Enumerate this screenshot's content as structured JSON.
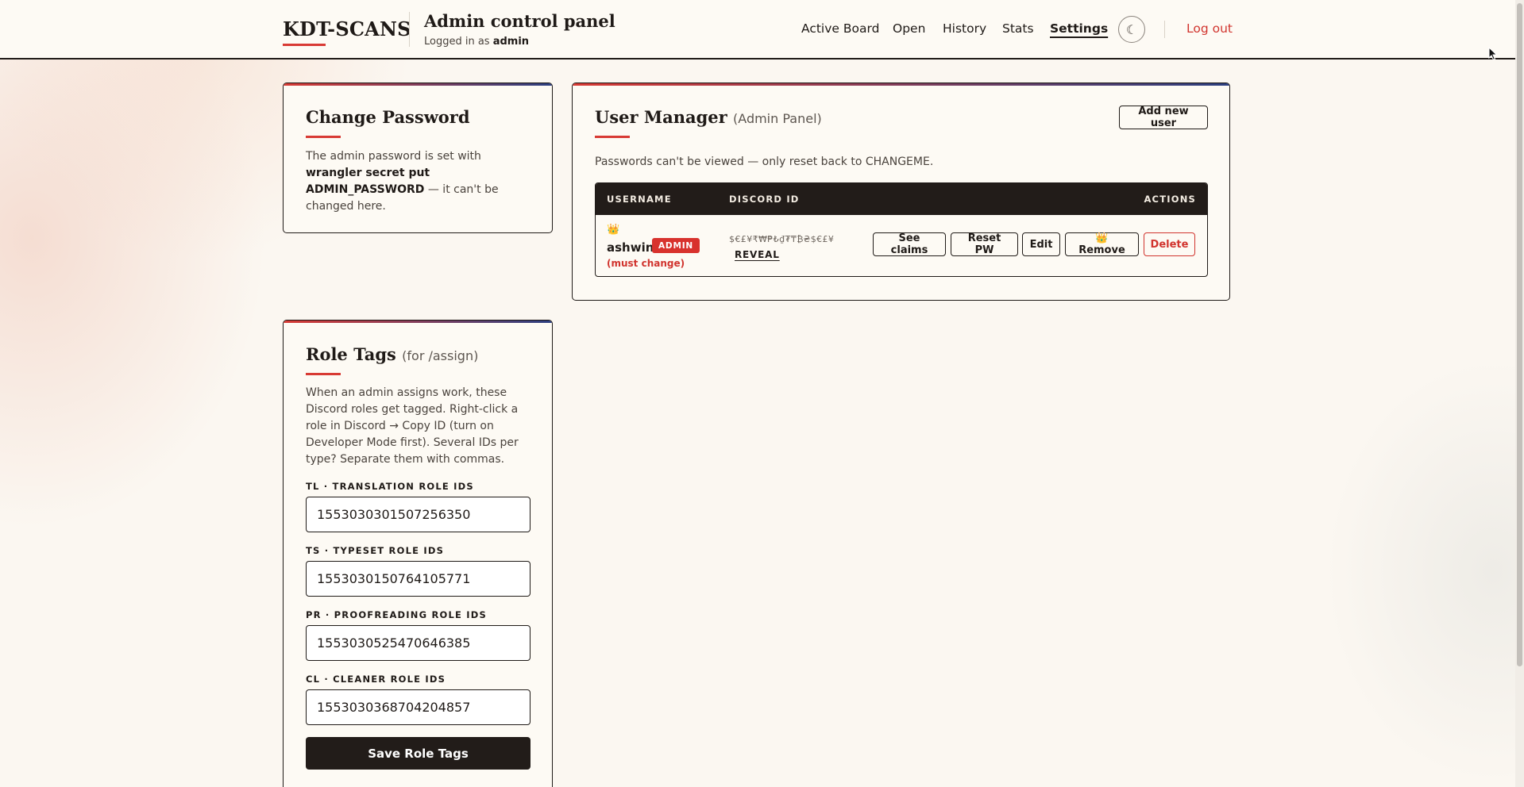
{
  "header": {
    "brand": "KDT-SCANS",
    "title": "Admin control panel",
    "logged_in_prefix": "Logged in as",
    "logged_in_user": "admin",
    "nav": [
      {
        "label": "Active Board"
      },
      {
        "label": "Open"
      },
      {
        "label": "History"
      },
      {
        "label": "Stats"
      },
      {
        "label": "Settings",
        "active": true
      }
    ],
    "theme_toggle_icon": "☾",
    "logout": "Log out"
  },
  "change_password": {
    "title": "Change Password",
    "text_1": "The admin password is set with ",
    "text_bold": "wrangler secret put ADMIN_PASSWORD",
    "text_2": " — it can't be changed here."
  },
  "user_manager": {
    "title": "User Manager",
    "subtitle": "(Admin Panel)",
    "add_button": "Add new user",
    "note": "Passwords can't be viewed — only reset back to CHANGEME.",
    "columns": {
      "username": "USERNAME",
      "discord_id": "DISCORD ID",
      "actions": "ACTIONS"
    },
    "rows": [
      {
        "crown": "👑",
        "username": "ashwin",
        "badge": "ADMIN",
        "status": "(must change)",
        "discord_masked": "$€£¥₹₩₱₺₫₮₸₿₴$€£¥",
        "reveal": "REVEAL",
        "actions": {
          "see_claims": "See claims",
          "reset_pw": "Reset PW",
          "edit": "Edit",
          "remove": "👑 Remove",
          "delete": "Delete"
        }
      }
    ]
  },
  "role_tags": {
    "title": "Role Tags",
    "subtitle": "(for /assign)",
    "description": "When an admin assigns work, these Discord roles get tagged. Right-click a role in Discord → Copy ID (turn on Developer Mode first). Several IDs per type? Separate them with commas.",
    "fields": [
      {
        "label": "TL · TRANSLATION ROLE IDS",
        "value": "1553030301507256350"
      },
      {
        "label": "TS · TYPESET ROLE IDS",
        "value": "1553030150764105771"
      },
      {
        "label": "PR · PROOFREADING ROLE IDS",
        "value": "1553030525470646385"
      },
      {
        "label": "CL · CLEANER ROLE IDS",
        "value": "1553030368704204857"
      }
    ],
    "save_button": "Save Role Tags"
  },
  "colors": {
    "accent_red": "#d83a34",
    "dark": "#221c19",
    "background": "#fbf7f1"
  }
}
